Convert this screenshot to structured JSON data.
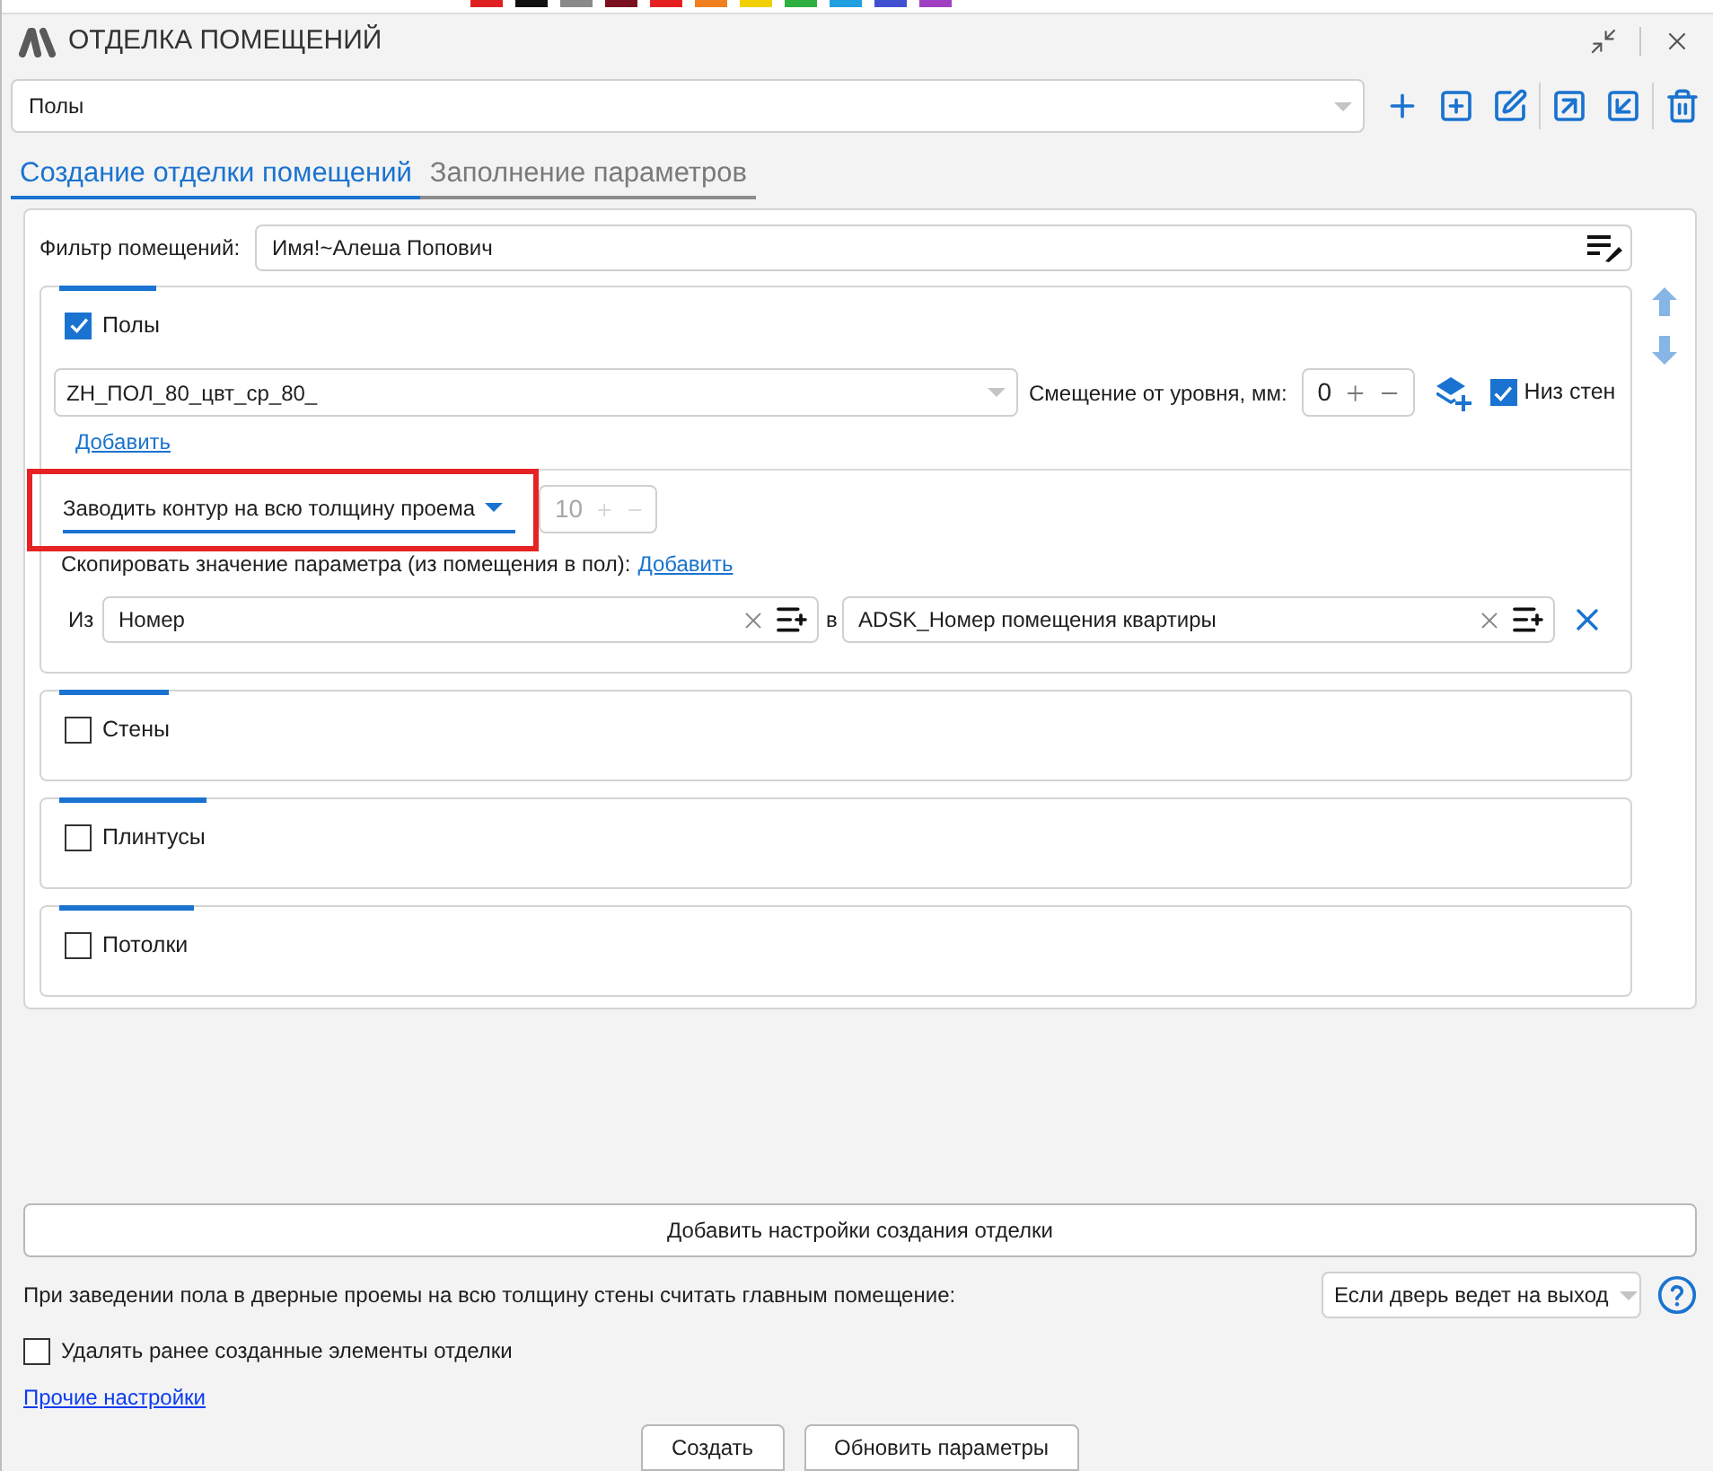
{
  "window": {
    "title": "ОТДЕЛКА ПОМЕЩЕНИЙ"
  },
  "preset": {
    "value": "Полы"
  },
  "tabs": [
    {
      "label": "Создание отделки помещений",
      "selected": true
    },
    {
      "label": "Заполнение параметров",
      "selected": false
    }
  ],
  "filter": {
    "label": "Фильтр помещений:",
    "value": "Имя!~Алеша Попович"
  },
  "sections": [
    {
      "label": "Полы",
      "checked": true,
      "details": {
        "finish": "ZH_ПОЛ_80_цвт_ср_80_",
        "offset_label": "Смещение от уровня, мм:",
        "offset_value": "0",
        "wall_bottom": {
          "label": "Низ стен",
          "checked": true
        },
        "add_link": "Добавить",
        "contour": {
          "value": "Заводить контур на всю толщину проема",
          "highlighted": true
        },
        "contour_offset": {
          "value": "10",
          "disabled": true
        },
        "copy_label": "Скопировать значение параметра (из помещения в пол):",
        "copy_link": "Добавить",
        "mappings": [
          {
            "from_label": "Из",
            "from": "Номер",
            "to_label": "в",
            "to": "ADSK_Номер помещения квартиры"
          }
        ]
      }
    },
    {
      "label": "Стены",
      "checked": false
    },
    {
      "label": "Плинтусы",
      "checked": false
    },
    {
      "label": "Потолки",
      "checked": false
    }
  ],
  "add_settings_button": "Добавить настройки создания отделки",
  "main_room": {
    "label": "При заведении пола в дверные проемы на всю толщину стены считать главным помещение:",
    "value": "Если дверь ведет на выход"
  },
  "delete_existing": {
    "label": "Удалять ранее созданные элементы отделки",
    "checked": false
  },
  "other_settings_link": "Прочие настройки",
  "buttons": [
    "Создать",
    "Обновить параметры"
  ]
}
